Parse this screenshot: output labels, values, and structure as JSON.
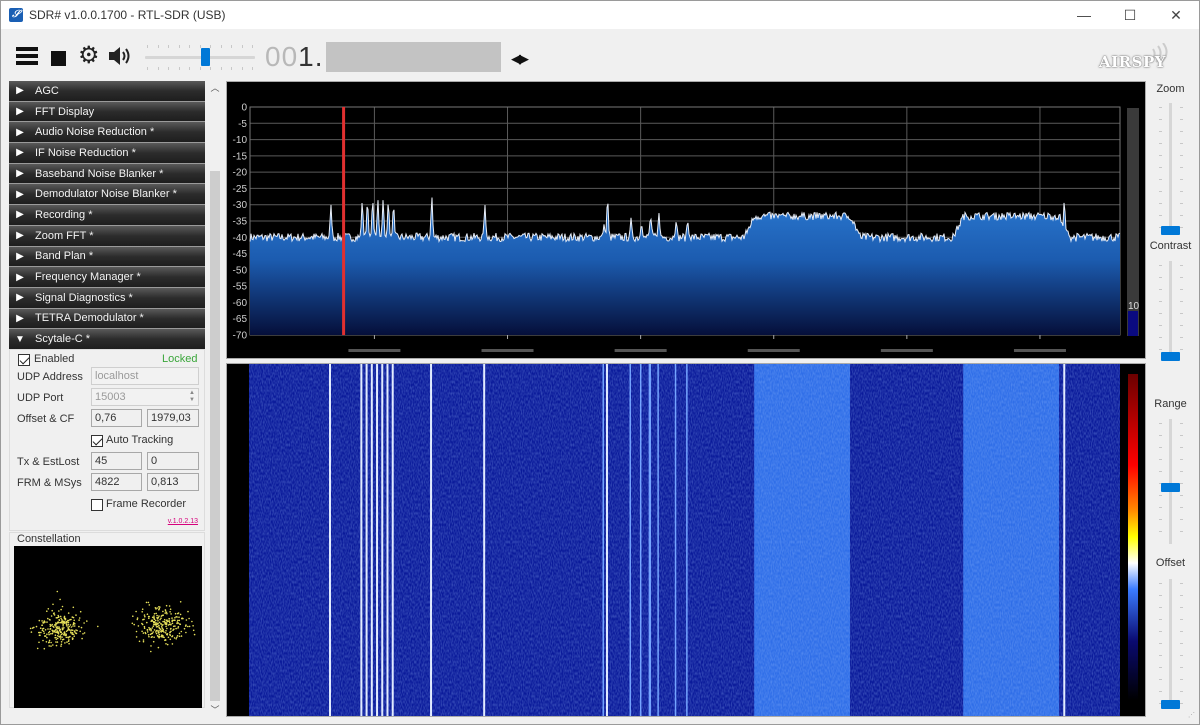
{
  "window": {
    "title": "SDR# v1.0.0.1700 - RTL-SDR (USB)",
    "app_icon": "sdrsharp-logo-icon",
    "controls": {
      "minimize": "—",
      "maximize": "☐",
      "close": "✕"
    }
  },
  "toolbar": {
    "menu_icon": "hamburger-menu-icon",
    "stop_icon": "stop-icon",
    "settings_icon": "gear-icon",
    "audio_icon": "speaker-icon",
    "volume_percent": 55,
    "frequency_prefix_dim": "00",
    "frequency_prefix": "1.",
    "frequency_hidden": true,
    "tune_arrows": "◀▶",
    "logo_text": "AIRSPY"
  },
  "sidebar": {
    "sections": [
      {
        "label": "AGC",
        "expanded": false
      },
      {
        "label": "FFT Display",
        "expanded": false
      },
      {
        "label": "Audio Noise Reduction *",
        "expanded": false
      },
      {
        "label": "IF Noise Reduction *",
        "expanded": false
      },
      {
        "label": "Baseband Noise Blanker *",
        "expanded": false
      },
      {
        "label": "Demodulator Noise Blanker *",
        "expanded": false
      },
      {
        "label": "Recording *",
        "expanded": false
      },
      {
        "label": "Zoom FFT *",
        "expanded": false
      },
      {
        "label": "Band Plan *",
        "expanded": false
      },
      {
        "label": "Frequency Manager *",
        "expanded": false
      },
      {
        "label": "Signal Diagnostics *",
        "expanded": false
      },
      {
        "label": "TETRA Demodulator *",
        "expanded": false
      },
      {
        "label": "Scytale-C *",
        "expanded": true
      }
    ],
    "arrow_collapsed": "▶",
    "arrow_expanded": "▼",
    "scytale": {
      "enabled_label": "Enabled",
      "enabled": true,
      "status": "Locked",
      "status_color": "#3aa63a",
      "udp_address_label": "UDP Address",
      "udp_address": "localhost",
      "udp_port_label": "UDP Port",
      "udp_port": "15003",
      "offset_cf_label": "Offset & CF",
      "offset": "0,76",
      "cf": "1979,03",
      "auto_tracking_label": "Auto Tracking",
      "auto_tracking": true,
      "tx_estlost_label": "Tx & EstLost",
      "tx": "45",
      "estlost": "0",
      "frm_msys_label": "FRM & MSys",
      "frm": "4822",
      "msys": "0,813",
      "frame_recorder_label": "Frame Recorder",
      "frame_recorder": false,
      "version": "v.1.0.2.13"
    },
    "constellation_label": "Constellation"
  },
  "spectrum": {
    "y_axis_labels": [
      "0",
      "-5",
      "-10",
      "-15",
      "-20",
      "-25",
      "-30",
      "-35",
      "-40",
      "-45",
      "-50",
      "-55",
      "-60",
      "-65",
      "-70"
    ],
    "y_min_db": -70,
    "y_max_db": 0,
    "noise_floor_db": -40,
    "frequency_labels_obscured": true,
    "peaks": [
      {
        "pos": 0.093,
        "db": -30
      },
      {
        "pos": 0.129,
        "db": -29
      },
      {
        "pos": 0.135,
        "db": -29
      },
      {
        "pos": 0.141,
        "db": -28.5
      },
      {
        "pos": 0.147,
        "db": -28.5
      },
      {
        "pos": 0.153,
        "db": -28.5
      },
      {
        "pos": 0.159,
        "db": -29
      },
      {
        "pos": 0.165,
        "db": -30
      },
      {
        "pos": 0.209,
        "db": -27.5
      },
      {
        "pos": 0.27,
        "db": -30
      },
      {
        "pos": 0.407,
        "db": -36
      },
      {
        "pos": 0.411,
        "db": -28
      },
      {
        "pos": 0.438,
        "db": -34
      },
      {
        "pos": 0.45,
        "db": -36
      },
      {
        "pos": 0.46,
        "db": -35
      },
      {
        "pos": 0.461,
        "db": -34.5
      },
      {
        "pos": 0.47,
        "db": -32.5
      },
      {
        "pos": 0.49,
        "db": -35
      },
      {
        "pos": 0.503,
        "db": -35
      },
      {
        "pos": 0.936,
        "db": -28.5
      }
    ],
    "humps": [
      {
        "start": 0.58,
        "end": 0.69,
        "db": -33.5
      },
      {
        "start": 0.82,
        "end": 0.93,
        "db": -33.5
      }
    ],
    "tuned_marker_pos": 0.107,
    "marker_color": "#e03030",
    "side_meter_value": "10"
  },
  "waterfall": {
    "colorbar": [
      "#000000",
      "#0a0a70",
      "#3b7cff",
      "#ffffff",
      "#ffff00",
      "#ff8c00",
      "#ff0000",
      "#8b0000"
    ]
  },
  "right_panel": {
    "zoom_label": "Zoom",
    "zoom_value": 0.0,
    "contrast_label": "Contrast",
    "contrast_value": 0.0,
    "range_label": "Range",
    "range_value": 0.45,
    "offset_label": "Offset",
    "offset_value": 0.0
  }
}
